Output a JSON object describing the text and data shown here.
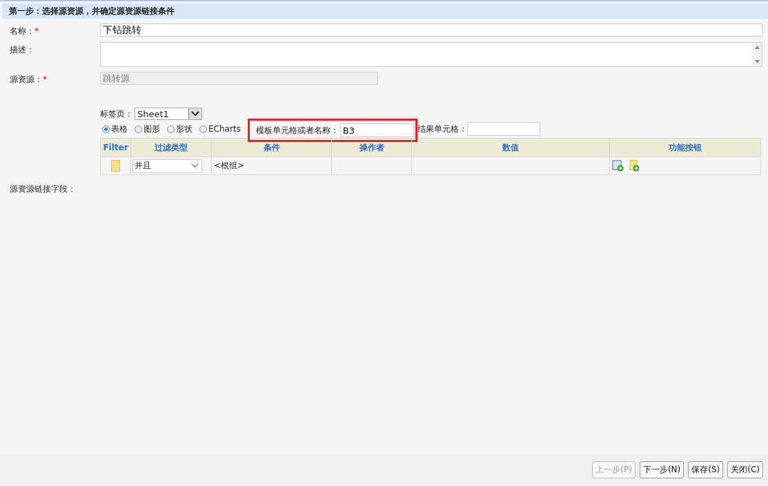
{
  "header": {
    "title": "第一步：选择源资源，并确定源资源链接条件"
  },
  "fields": [
    {
      "kind": "input",
      "label": "名称：",
      "required_mark": "*",
      "value": "下钻跳转"
    },
    {
      "kind": "textarea",
      "label": "描述："
    },
    {
      "kind": "readonly",
      "label": "源资源：",
      "required_mark": "*",
      "value": "跳转源"
    }
  ],
  "sheet": {
    "label": "标签页：",
    "value": "Sheet1"
  },
  "types": [
    {
      "label": "表格",
      "selected": true
    },
    {
      "label": "图形",
      "selected": false
    },
    {
      "label": "形状",
      "selected": false
    },
    {
      "label": "ECharts",
      "selected": false
    }
  ],
  "template_cell": {
    "label": "模板单元格或者名称：",
    "value": "B3",
    "highlighted": true
  },
  "result_cell": {
    "label": "结果单元格："
  },
  "table": {
    "columns": [
      "Filter",
      "过滤类型",
      "条件",
      "操作者",
      "数值",
      "功能按钮"
    ],
    "rows": [
      {
        "type": "并且",
        "condition": "<根组>"
      }
    ]
  },
  "link_fields": {
    "label": "源资源链接字段："
  },
  "buttons": [
    {
      "label": "上一步(P)",
      "disabled": true
    },
    {
      "label": "下一步(N)",
      "disabled": false
    },
    {
      "label": "保存(S)",
      "disabled": false
    },
    {
      "label": "关闭(C)",
      "disabled": false
    }
  ]
}
